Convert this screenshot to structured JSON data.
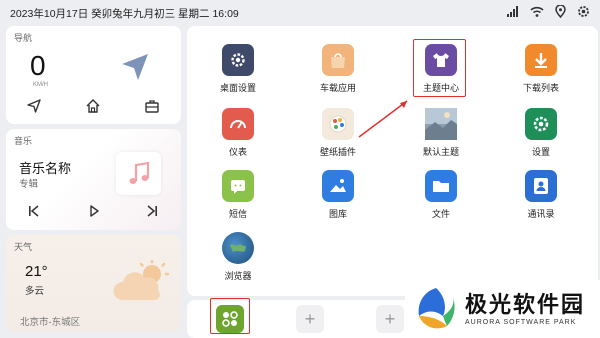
{
  "status_bar": {
    "text": "2023年10月17日  癸卯兔年九月初三  星期二  16:09",
    "icons": [
      "signal-icon",
      "wifi-icon",
      "location-icon",
      "settings-icon"
    ]
  },
  "nav_card": {
    "title": "导航",
    "speed": "0",
    "unit": "KM/H",
    "icons": [
      "navigate-icon",
      "home-icon",
      "work-icon"
    ]
  },
  "music_card": {
    "title": "音乐",
    "song": "音乐名称",
    "album": "专辑",
    "controls": [
      "previous-icon",
      "play-icon",
      "next-icon"
    ]
  },
  "weather_card": {
    "title": "天气",
    "temperature": "21°",
    "condition": "多云",
    "location": "北京市-东城区"
  },
  "apps": [
    {
      "label": "桌面设置",
      "icon": "desktop-settings-icon",
      "color": "#3f4a6b"
    },
    {
      "label": "车载应用",
      "icon": "car-apps-icon",
      "color": "#f2b47a"
    },
    {
      "label": "主题中心",
      "icon": "theme-center-icon",
      "color": "#6a4ca3"
    },
    {
      "label": "下载列表",
      "icon": "download-list-icon",
      "color": "#f08a2c"
    },
    {
      "label": "仪表",
      "icon": "dashboard-icon",
      "color": "#e25b4c"
    },
    {
      "label": "壁纸插件",
      "icon": "wallpaper-plugin-icon",
      "color": "#f3e9dc"
    },
    {
      "label": "默认主题",
      "icon": "default-theme-icon",
      "color": "#8aa0b0"
    },
    {
      "label": "设置",
      "icon": "settings-app-icon",
      "color": "#1f8f5a"
    },
    {
      "label": "短信",
      "icon": "sms-icon",
      "color": "#8bc34a"
    },
    {
      "label": "图库",
      "icon": "gallery-icon",
      "color": "#2f7de1"
    },
    {
      "label": "文件",
      "icon": "files-icon",
      "color": "#2f7de1"
    },
    {
      "label": "通讯录",
      "icon": "contacts-icon",
      "color": "#2a6fd1"
    },
    {
      "label": "浏览器",
      "icon": "browser-icon",
      "color": "#2a5d8f"
    }
  ],
  "dock": {
    "add_label": "+"
  },
  "watermark": {
    "name": "极光软件园",
    "sub": "AURORA SOFTWARE PARK"
  }
}
